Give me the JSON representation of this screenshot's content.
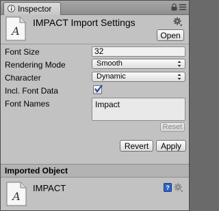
{
  "tab": {
    "label": "Inspector"
  },
  "header": {
    "title": "IMPACT Import Settings",
    "open_label": "Open"
  },
  "fields": {
    "font_size": {
      "label": "Font Size",
      "value": "32"
    },
    "rendering_mode": {
      "label": "Rendering Mode",
      "value": "Smooth"
    },
    "character": {
      "label": "Character",
      "value": "Dynamic"
    },
    "incl_font_data": {
      "label": "Incl. Font Data",
      "checked": true
    },
    "font_names": {
      "label": "Font Names",
      "value": "Impact"
    }
  },
  "buttons": {
    "reset": "Reset",
    "revert": "Revert",
    "apply": "Apply"
  },
  "imported": {
    "section_title": "Imported Object",
    "name": "IMPACT"
  },
  "icons": {
    "tab": "inspector-icon",
    "lock": "lock-icon",
    "menu": "tab-menu-icon",
    "asset": "font-asset-icon",
    "gear": "gear-icon",
    "help": "help-book-icon"
  },
  "colors": {
    "panel": "#c2c2c2",
    "checkmark": "#1f4a9c",
    "help": "#2d63c8"
  }
}
